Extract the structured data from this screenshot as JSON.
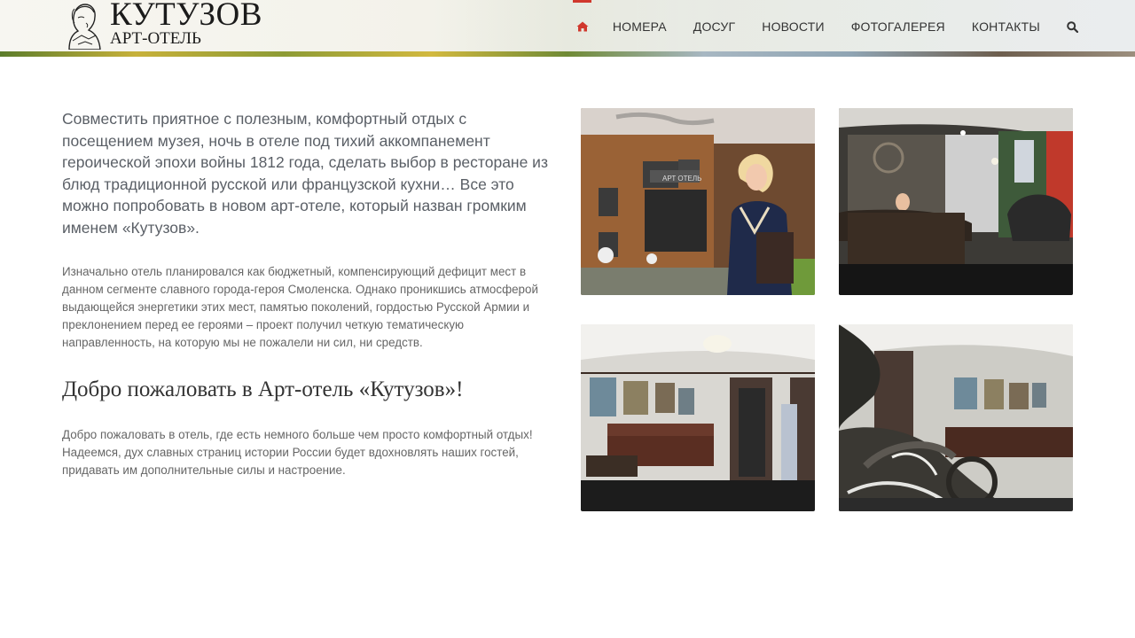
{
  "header": {
    "logo": {
      "title": "КУТУЗОВ",
      "subtitle": "АРТ-ОТЕЛЬ"
    },
    "nav": {
      "home_icon": "home-icon",
      "items": [
        {
          "label": "НОМЕРА"
        },
        {
          "label": "ДОСУГ"
        },
        {
          "label": "НОВОСТИ"
        },
        {
          "label": "ФОТОГАЛЕРЕЯ"
        },
        {
          "label": "КОНТАКТЫ"
        }
      ],
      "search_icon": "search-icon",
      "active_color": "#d0382d"
    }
  },
  "main": {
    "lead": "Совместить приятное с полезным, комфортный отдых с посещением музея, ночь в отеле под тихий аккомпанемент героической эпохи войны 1812 года, сделать выбор в ресторане из блюд традиционной русской или французской кухни… Все это можно попробовать в новом арт-отеле, который назван громким именем «Кутузов».",
    "paragraph1": "Изначально отель планировался как бюджетный, компенсирующий дефицит мест в данном сегменте славного города-героя Смоленска. Однако проникшись атмосферой выдающейся энергетики этих мест, памятью поколений, гордостью Русской Армии и преклонением перед ее героями – проект получил четкую тематическую направленность, на которую мы не пожалели ни сил, ни средств.",
    "heading": "Добро пожаловать в Арт-отель «Кутузов»!",
    "paragraph2": "Добро пожаловать в отель, где есть немного больше чем просто комфортный отдых! Надеемся, дух славных страниц истории России будет вдохновлять наших гостей, придавать им дополнительные силы и настроение."
  },
  "gallery": {
    "photos": [
      {
        "name": "hotel-facade-photo"
      },
      {
        "name": "reception-photo"
      },
      {
        "name": "lobby-photo"
      },
      {
        "name": "sculpture-lobby-photo"
      }
    ]
  }
}
